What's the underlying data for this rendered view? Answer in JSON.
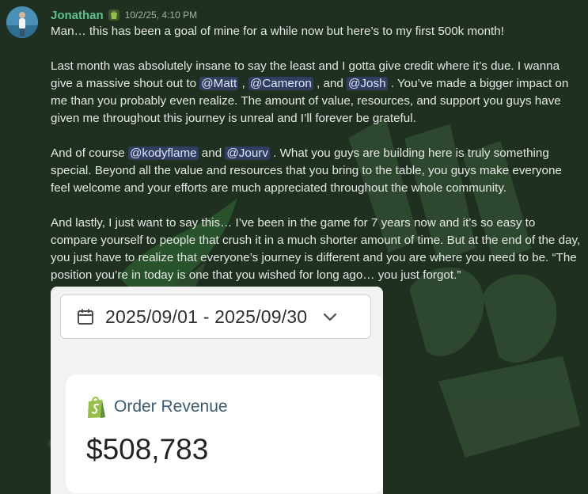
{
  "message": {
    "author": "Jonathan",
    "timestamp": "10/2/25, 4:10 PM",
    "author_color": "#5fc08f",
    "p1": "Man… this has been a goal of mine for a while now but here’s to my first 500k month!",
    "p2": {
      "t1": "Last month was absolutely insane to say the least and I gotta give credit where it’s due. I wanna give a massive shout out to ",
      "m1": "@Matt",
      "t2": " , ",
      "m2": "@Cameron",
      "t3": " , and ",
      "m3": "@Josh",
      "t4": " . You’ve made a bigger impact on me than you probably even realize. The amount of value, resources, and support you guys have given me throughout this journey is unreal and I’ll forever be grateful."
    },
    "p3": {
      "t1": "And of course ",
      "m1": "@kodyflame",
      "t2": "  and ",
      "m2": "@Jourv",
      "t3": " . What you guys are building here is truly something special. Beyond all the value and resources that you bring to the table, you guys make everyone feel welcome and your efforts are much appreciated throughout the whole community."
    },
    "p4": "And lastly, I just want to say this… I’ve been in the game for 7 years now and it’s so easy to compare yourself to people that crush it in a much shorter amount of time. But at the end of the day, you just have to realize that everyone’s journey is different and you are where you need to be. “The position you’re in today is one that you wished for long ago… you just forgot.”"
  },
  "embed": {
    "date_range": "2025/09/01 - 2025/09/30",
    "card_title": "Order Revenue",
    "revenue": "$508,783"
  },
  "icons": {
    "role": "shopify-icon",
    "calendar": "calendar-icon",
    "dropdown": "chevron-down-icon",
    "card": "shopify-bag-icon"
  },
  "colors": {
    "background": "#1f3020",
    "mention_bg": "#3f4a85",
    "shopify_green": "#95bf47"
  }
}
